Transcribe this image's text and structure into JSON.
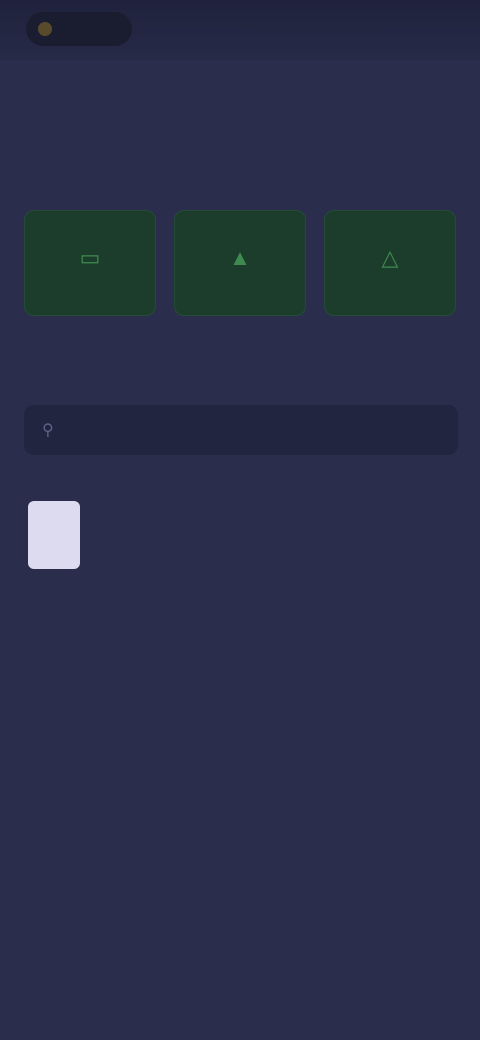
{
  "status_bar": {
    "left_label": "",
    "right_label": ""
  },
  "header": {
    "title": "",
    "action_label": ""
  },
  "quick_actions": {
    "section_title": "",
    "tiles": [
      {
        "icon": "scan-icon",
        "label": ""
      },
      {
        "icon": "import-icon",
        "label": ""
      },
      {
        "icon": "create-icon",
        "label": ""
      }
    ],
    "tile_color": "#1c3d2c"
  },
  "documents": {
    "section_title": "",
    "view_all_label": "",
    "search_placeholder": "",
    "items": [
      {
        "name": "",
        "meta": ""
      }
    ]
  },
  "colors": {
    "background": "#2a2d4c",
    "accent_green": "#3f8a4e"
  }
}
